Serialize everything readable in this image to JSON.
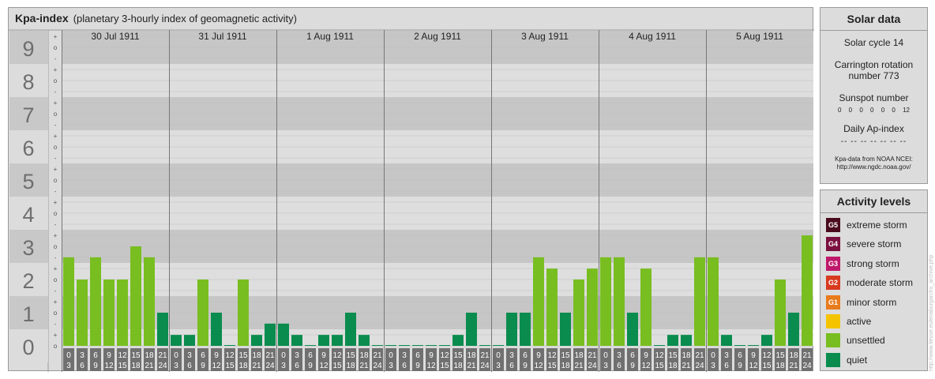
{
  "header": {
    "title": "Kpa-index",
    "subtitle": "(planetary 3-hourly index of geomagnetic activity)"
  },
  "chart_data": {
    "type": "bar",
    "title": "Kpa-index",
    "subtitle": "(planetary 3-hourly index of geomagnetic activity)",
    "ylim": [
      0,
      9
    ],
    "y_ticks": [
      "0",
      "1",
      "2",
      "3",
      "4",
      "5",
      "6",
      "7",
      "8",
      "9"
    ],
    "sub_ticks": [
      "+",
      "o",
      "-"
    ],
    "grid": true,
    "days": [
      "30 Jul 1911",
      "31 Jul 1911",
      "1 Aug 1911",
      "2 Aug 1911",
      "3 Aug 1911",
      "4 Aug 1911",
      "5 Aug 1911"
    ],
    "interval_labels": [
      [
        "0",
        "3"
      ],
      [
        "3",
        "6"
      ],
      [
        "6",
        "9"
      ],
      [
        "9",
        "12"
      ],
      [
        "12",
        "15"
      ],
      [
        "15",
        "18"
      ],
      [
        "18",
        "21"
      ],
      [
        "21",
        "24"
      ]
    ],
    "values": [
      2.67,
      2.0,
      2.67,
      2.0,
      2.0,
      3.0,
      2.67,
      1.0,
      0.33,
      0.33,
      2.0,
      1.0,
      0.0,
      2.0,
      0.33,
      0.67,
      0.67,
      0.33,
      0.0,
      0.33,
      0.33,
      1.0,
      0.33,
      0.0,
      0.0,
      0.0,
      0.0,
      -0.33,
      -0.33,
      0.33,
      1.0,
      0.0,
      0.0,
      1.0,
      1.0,
      2.67,
      2.33,
      1.0,
      2.0,
      2.33,
      2.67,
      2.67,
      1.0,
      2.33,
      0.0,
      0.33,
      0.33,
      2.67,
      2.67,
      0.33,
      0.0,
      0.0,
      0.33,
      2.0,
      1.0,
      3.33
    ],
    "colors": {
      "quiet": "#0a8c4e",
      "unsettled": "#78be20"
    }
  },
  "solar": {
    "title": "Solar data",
    "cycle": "Solar cycle 14",
    "carrington": "Carrington rotation number 773",
    "sunspot_label": "Sunspot number",
    "sunspot_values": [
      "0",
      "0",
      "0",
      "0",
      "0",
      "0",
      "12"
    ],
    "ap_label": "Daily Ap-index",
    "ap_values": [
      "--",
      "--",
      "--",
      "--",
      "--",
      "--",
      "--"
    ],
    "source_line1": "Kpa-data from NOAA NCEI:",
    "source_line2": "http://www.ngdc.noaa.gov/"
  },
  "activity": {
    "title": "Activity levels",
    "levels": [
      {
        "code": "G5",
        "label": "extreme storm",
        "color": "#4a0a1e"
      },
      {
        "code": "G4",
        "label": "severe storm",
        "color": "#7a1040"
      },
      {
        "code": "G3",
        "label": "strong storm",
        "color": "#c0186a"
      },
      {
        "code": "G2",
        "label": "moderate storm",
        "color": "#d83a20"
      },
      {
        "code": "G1",
        "label": "minor storm",
        "color": "#e87b1c"
      },
      {
        "code": "",
        "label": "active",
        "color": "#f5c400"
      },
      {
        "code": "",
        "label": "unsettled",
        "color": "#78be20"
      },
      {
        "code": "",
        "label": "quiet",
        "color": "#0a8c4e"
      }
    ]
  },
  "credit": "http://www.tleuse.euleriaburgarcho_archive.php"
}
